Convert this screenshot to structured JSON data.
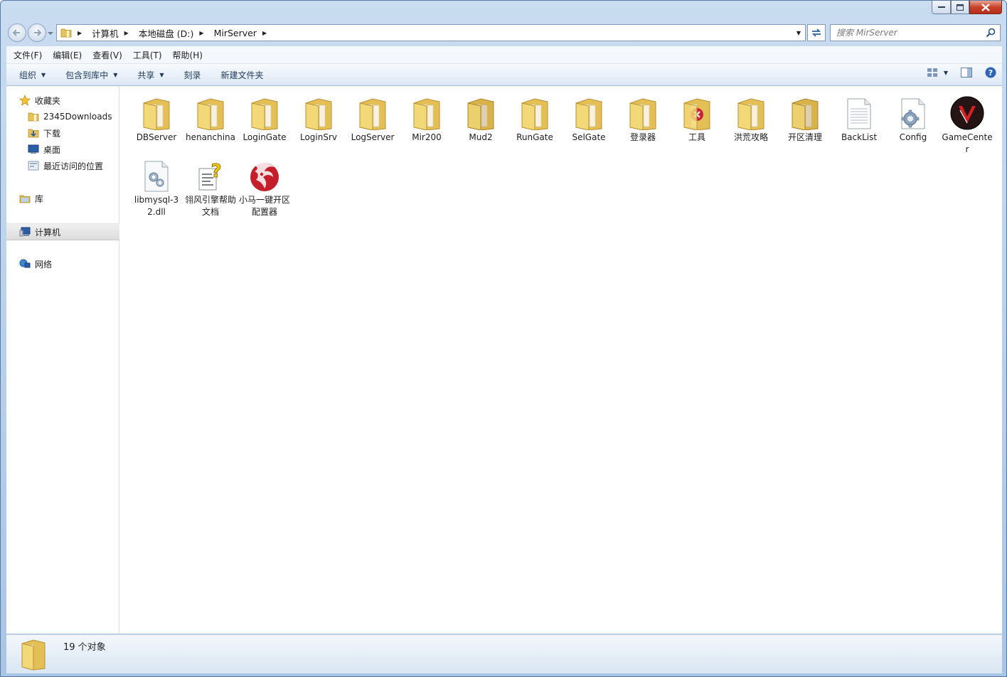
{
  "window": {
    "path": [
      "计算机",
      "本地磁盘 (D:)",
      "MirServer"
    ],
    "search_placeholder": "搜索 MirServer"
  },
  "menu": [
    "文件(F)",
    "编辑(E)",
    "查看(V)",
    "工具(T)",
    "帮助(H)"
  ],
  "toolbar": {
    "organize": "组织",
    "include_library": "包含到库中",
    "share": "共享",
    "burn": "刻录",
    "new_folder": "新建文件夹"
  },
  "sidebar": {
    "favorites": "收藏夹",
    "downloads2345": "2345Downloads",
    "downloads": "下载",
    "desktop": "桌面",
    "recent": "最近访问的位置",
    "libraries": "库",
    "computer": "计算机",
    "network": "网络"
  },
  "files": [
    {
      "name": "DBServer",
      "icon": "folder-icon"
    },
    {
      "name": "henanchina",
      "icon": "folder-icon"
    },
    {
      "name": "LoginGate",
      "icon": "folder-icon"
    },
    {
      "name": "LoginSrv",
      "icon": "folder-icon"
    },
    {
      "name": "LogServer",
      "icon": "folder-icon"
    },
    {
      "name": "Mir200",
      "icon": "folder-icon"
    },
    {
      "name": "Mud2",
      "icon": "folder-icon"
    },
    {
      "name": "RunGate",
      "icon": "folder-icon"
    },
    {
      "name": "SelGate",
      "icon": "folder-icon"
    },
    {
      "name": "登录器",
      "icon": "folder-icon"
    },
    {
      "name": "工具",
      "icon": "folder-icon"
    },
    {
      "name": "洪荒攻略",
      "icon": "folder-icon"
    },
    {
      "name": "开区清理",
      "icon": "folder-icon"
    },
    {
      "name": "BackList",
      "icon": "text-file-icon"
    },
    {
      "name": "Config",
      "icon": "config-file-icon"
    },
    {
      "name": "GameCenter",
      "icon": "gamecenter-app-icon"
    },
    {
      "name": "libmysql-32.dll",
      "icon": "dll-file-icon"
    },
    {
      "name": "翎风引擎帮助文档",
      "icon": "help-file-icon"
    },
    {
      "name": "小马一键开区配置器",
      "icon": "dragon-app-icon"
    }
  ],
  "status": {
    "count": "19 个对象"
  }
}
